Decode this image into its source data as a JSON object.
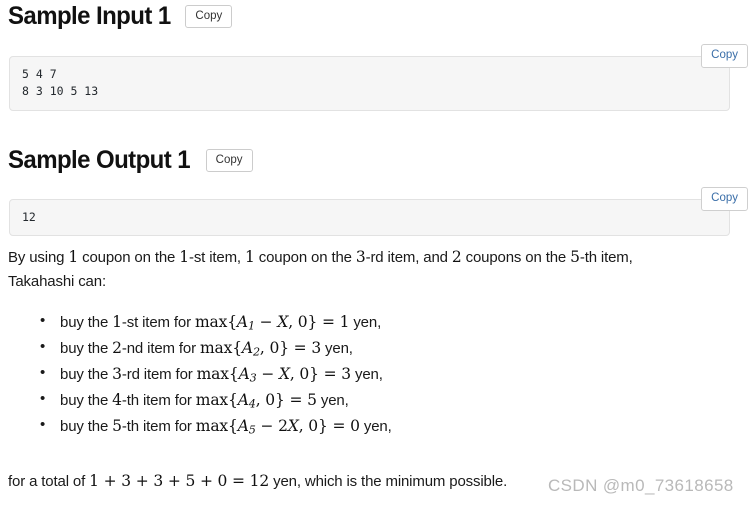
{
  "sample_input": {
    "heading": "Sample Input 1",
    "copy_label": "Copy",
    "block_copy_label": "Copy",
    "content": "5 4 7\n8 3 10 5 13"
  },
  "sample_output": {
    "heading": "Sample Output 1",
    "copy_label": "Copy",
    "block_copy_label": "Copy",
    "content": "12"
  },
  "explanation": {
    "intro_a": "By using ",
    "intro_n1": "1",
    "intro_b": " coupon on the ",
    "intro_n2": "1",
    "intro_c": "-st item, ",
    "intro_n3": "1",
    "intro_d": " coupon on the ",
    "intro_n4": "3",
    "intro_e": "-rd item, and ",
    "intro_n5": "2",
    "intro_f": " coupons on the ",
    "intro_n6": "5",
    "intro_g": "-th item,",
    "intro_line2": "Takahashi can:"
  },
  "bullets": [
    {
      "prefix": "buy the ",
      "ordinal_num": "1",
      "ordinal_suffix": "-st item for ",
      "math_op": "max",
      "math_brace_open": "{",
      "math_var": "A",
      "math_sub": "1",
      "math_mid": " − ",
      "math_term": "X",
      "math_zero": ", 0",
      "math_brace_close": "}",
      "math_eq": " = ",
      "math_result": "1",
      "suffix": " yen,"
    },
    {
      "prefix": "buy the ",
      "ordinal_num": "2",
      "ordinal_suffix": "-nd item for ",
      "math_op": "max",
      "math_brace_open": "{",
      "math_var": "A",
      "math_sub": "2",
      "math_mid": "",
      "math_term": "",
      "math_zero": ", 0",
      "math_brace_close": "}",
      "math_eq": " = ",
      "math_result": "3",
      "suffix": " yen,"
    },
    {
      "prefix": "buy the ",
      "ordinal_num": "3",
      "ordinal_suffix": "-rd item for ",
      "math_op": "max",
      "math_brace_open": "{",
      "math_var": "A",
      "math_sub": "3",
      "math_mid": " − ",
      "math_term": "X",
      "math_zero": ", 0",
      "math_brace_close": "}",
      "math_eq": " = ",
      "math_result": "3",
      "suffix": " yen,"
    },
    {
      "prefix": "buy the ",
      "ordinal_num": "4",
      "ordinal_suffix": "-th item for ",
      "math_op": "max",
      "math_brace_open": "{",
      "math_var": "A",
      "math_sub": "4",
      "math_mid": "",
      "math_term": "",
      "math_zero": ", 0",
      "math_brace_close": "}",
      "math_eq": " = ",
      "math_result": "5",
      "suffix": " yen,"
    },
    {
      "prefix": "buy the ",
      "ordinal_num": "5",
      "ordinal_suffix": "-th item for ",
      "math_op": "max",
      "math_brace_open": "{",
      "math_var": "A",
      "math_sub": "5",
      "math_mid": " − 2",
      "math_term": "X",
      "math_zero": ", 0",
      "math_brace_close": "}",
      "math_eq": " = ",
      "math_result": "0",
      "suffix": " yen,"
    }
  ],
  "total": {
    "prefix": "for a total of ",
    "expression": "1 + 3 + 3 + 5 + 0 = 12",
    "suffix": " yen, which is the minimum possible."
  },
  "watermark": {
    "text": "CSDN @m0_73618658"
  },
  "colors": {
    "code_bg": "#f6f6f6",
    "code_border": "#e2e2e2",
    "button_border": "#cccccc",
    "text": "#1a1a1a",
    "watermark": "#b9b9b9"
  }
}
